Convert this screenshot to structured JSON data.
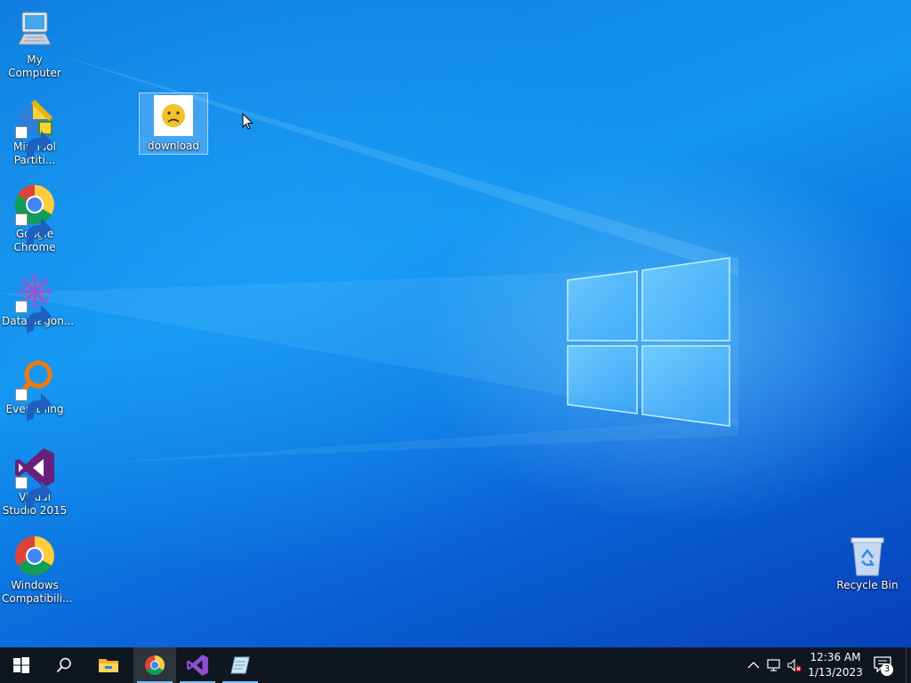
{
  "desktop": {
    "icons": [
      {
        "label": "My Computer",
        "icon": "computer-icon"
      },
      {
        "label": "MiniTool Partiti...",
        "icon": "minitool-icon",
        "shortcut": true
      },
      {
        "label": "Google Chrome",
        "icon": "chrome-icon",
        "shortcut": true
      },
      {
        "label": "DataWagon...",
        "icon": "datawagon-icon",
        "shortcut": true
      },
      {
        "label": "Everything",
        "icon": "everything-search-icon",
        "shortcut": true
      },
      {
        "label": "Visual Studio 2015",
        "icon": "visual-studio-icon",
        "shortcut": true
      },
      {
        "label": "Windows Compatibili...",
        "icon": "chrome-icon"
      },
      {
        "label": "download",
        "icon": "sad-face-image-icon",
        "selected": true
      },
      {
        "label": "Recycle Bin",
        "icon": "recycle-bin-icon"
      }
    ]
  },
  "taskbar": {
    "buttons": [
      {
        "name": "start",
        "icon": "windows-start-icon"
      },
      {
        "name": "search",
        "icon": "search-icon"
      },
      {
        "name": "file-explorer",
        "icon": "folder-icon"
      },
      {
        "name": "chrome",
        "icon": "chrome-icon",
        "active": true
      },
      {
        "name": "visual-studio",
        "icon": "visual-studio-icon"
      },
      {
        "name": "app",
        "icon": "notepad-icon"
      }
    ],
    "tray": {
      "icons": [
        "chevron-up-icon",
        "network-icon",
        "volume-muted-icon"
      ],
      "time": "12:36 AM",
      "date": "1/13/2023",
      "notification_count": "3"
    }
  },
  "colors": {
    "desktop_bg": "#0f7fe0",
    "taskbar_bg": "#101620",
    "selection": "#a0cdff",
    "active_underline": "#76b9ed"
  }
}
